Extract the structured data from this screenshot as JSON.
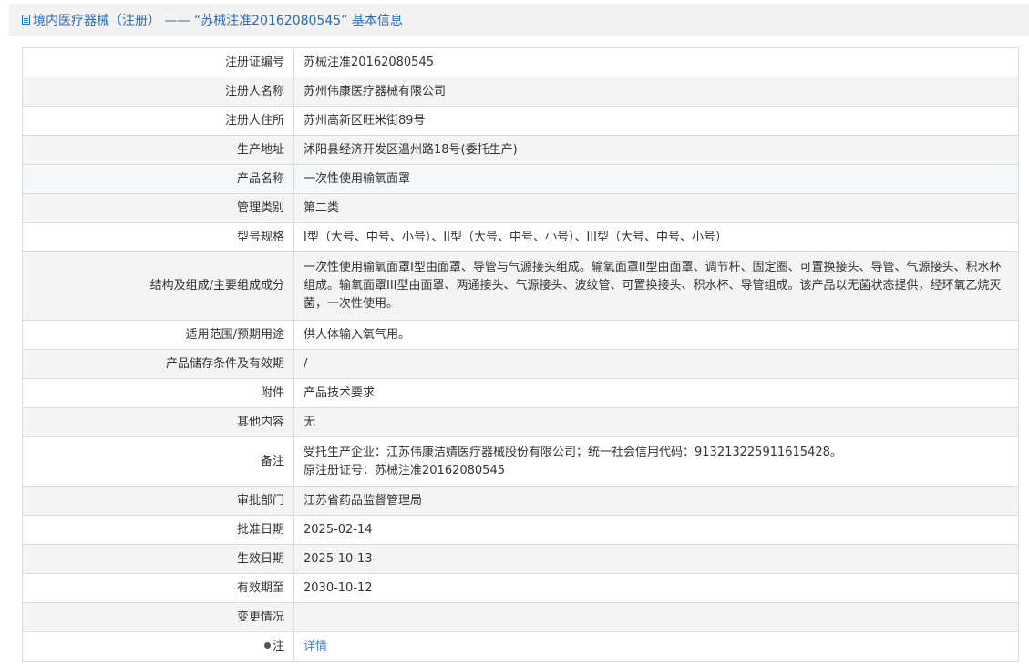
{
  "header": {
    "title": "境内医疗器械（注册） —— “苏械注准20162080545” 基本信息"
  },
  "rows": [
    {
      "label": "注册证编号",
      "value": "苏械注准20162080545"
    },
    {
      "label": "注册人名称",
      "value": "苏州伟康医疗器械有限公司"
    },
    {
      "label": "注册人住所",
      "value": "苏州高新区旺米街89号"
    },
    {
      "label": "生产地址",
      "value": "沭阳县经济开发区温州路18号(委托生产)"
    },
    {
      "label": "产品名称",
      "value": "一次性使用输氧面罩"
    },
    {
      "label": "管理类别",
      "value": "第二类"
    },
    {
      "label": "型号规格",
      "value": "I型（大号、中号、小号）、II型（大号、中号、小号）、III型（大号、中号、小号）"
    },
    {
      "label": "结构及组成/主要组成成分",
      "value": "一次性使用输氧面罩I型由面罩、导管与气源接头组成。输氧面罩II型由面罩、调节杆、固定圈、可置换接头、导管、气源接头、积水杯组成。输氧面罩III型由面罩、两通接头、气源接头、波纹管、可置换接头、积水杯、导管组成。该产品以无菌状态提供，经环氧乙烷灭菌，一次性使用。"
    },
    {
      "label": "适用范围/预期用途",
      "value": "供人体输入氧气用。"
    },
    {
      "label": "产品储存条件及有效期",
      "value": "/"
    },
    {
      "label": "附件",
      "value": "产品技术要求"
    },
    {
      "label": "其他内容",
      "value": "无"
    },
    {
      "label": "备注",
      "value_line1": "受托生产企业：江苏伟康洁婧医疗器械股份有限公司；统一社会信用代码：913213225911615428。",
      "value_line2": "原注册证号：苏械注准20162080545"
    },
    {
      "label": "审批部门",
      "value": "江苏省药品监督管理局"
    },
    {
      "label": "批准日期",
      "value": "2025-02-14"
    },
    {
      "label": "生效日期",
      "value": "2025-10-13"
    },
    {
      "label": "有效期至",
      "value": "2030-10-12"
    },
    {
      "label": "变更情况",
      "value": ""
    },
    {
      "label": "注",
      "value": "详情"
    }
  ],
  "icons": {
    "title_icon": "document-icon",
    "note_icon": "pin-icon"
  },
  "colors": {
    "title_text": "#2a6bb5",
    "link": "#3a7fd5",
    "row_alt": "#f4f4f4",
    "border": "#dcdcdc"
  }
}
